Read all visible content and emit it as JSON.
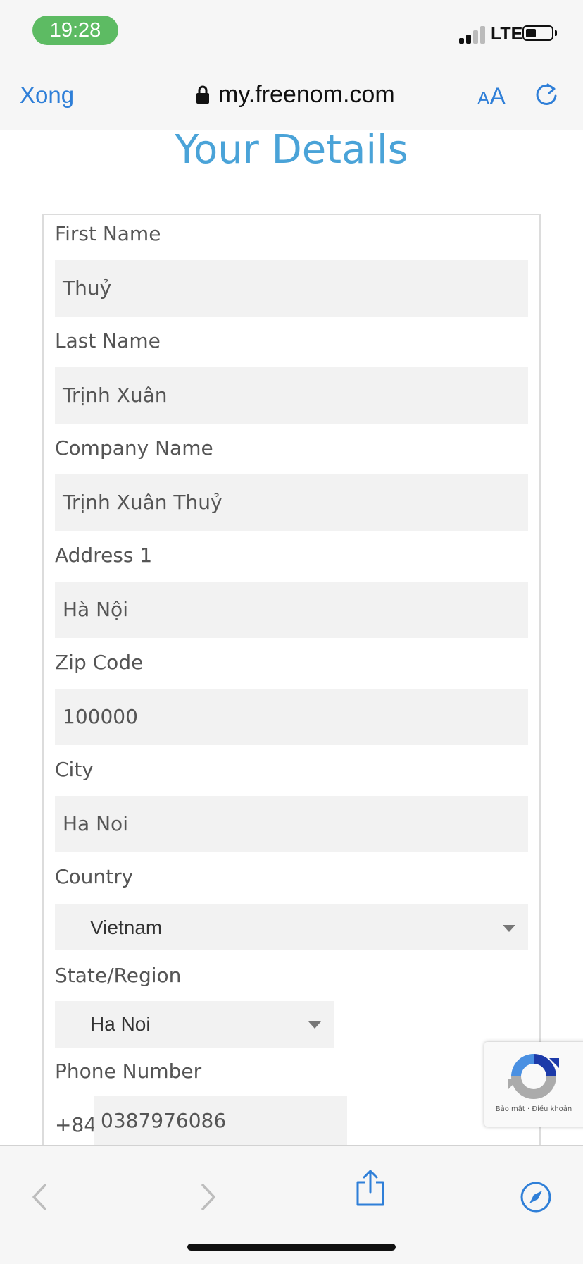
{
  "status_bar": {
    "time": "19:28",
    "network": "LTE"
  },
  "browser": {
    "done_label": "Xong",
    "url": "my.freenom.com",
    "text_size_label_small": "A",
    "text_size_label_large": "A"
  },
  "page": {
    "title": "Your Details",
    "fields": {
      "first_name": {
        "label": "First Name",
        "value": "Thuỷ"
      },
      "last_name": {
        "label": "Last Name",
        "value": "Trịnh Xuân"
      },
      "company_name": {
        "label": "Company Name",
        "value": "Trịnh Xuân Thuỷ"
      },
      "address1": {
        "label": "Address 1",
        "value": "Hà Nội"
      },
      "zip_code": {
        "label": "Zip Code",
        "value": "100000"
      },
      "city": {
        "label": "City",
        "value": "Ha Noi"
      },
      "country": {
        "label": "Country",
        "value": "Vietnam"
      },
      "state": {
        "label": "State/Region",
        "value": "Ha Noi"
      },
      "phone": {
        "label": "Phone Number",
        "prefix": "+84",
        "value": "0387976086"
      }
    }
  },
  "recaptcha": {
    "privacy": "Bảo mật",
    "separator": "·",
    "terms": "Điều khoản"
  },
  "colors": {
    "accent": "#2f7fd8",
    "title": "#4aa3d8",
    "time_pill": "#5dbb63",
    "field_bg": "#f2f2f2"
  },
  "icons": [
    "lock-icon",
    "reload-icon",
    "back-icon",
    "forward-icon",
    "share-icon",
    "compass-icon",
    "recaptcha-icon"
  ]
}
